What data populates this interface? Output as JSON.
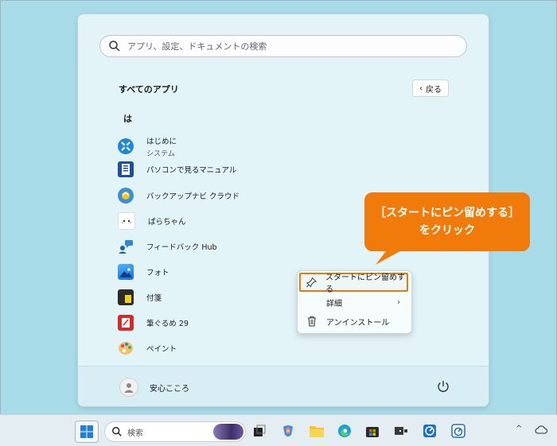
{
  "start_menu": {
    "search_placeholder": "アプリ、設定、ドキュメントの検索",
    "all_apps_title": "すべてのアプリ",
    "back_label": "戻る",
    "section_letter": "は",
    "apps": [
      {
        "name": "はじめに",
        "sub": "システム",
        "icon": "tips-icon"
      },
      {
        "name": "パソコンで見るマニュアル",
        "sub": "",
        "icon": "manual-icon"
      },
      {
        "name": "バックアップナビ クラウド",
        "sub": "",
        "icon": "backup-navi-icon"
      },
      {
        "name": "ぱらちゃん",
        "sub": "",
        "icon": "parachan-icon"
      },
      {
        "name": "フィードバック Hub",
        "sub": "",
        "icon": "feedback-hub-icon"
      },
      {
        "name": "フォト",
        "sub": "",
        "icon": "photos-icon"
      },
      {
        "name": "付箋",
        "sub": "",
        "icon": "sticky-notes-icon"
      },
      {
        "name": "筆ぐるめ 29",
        "sub": "",
        "icon": "fudegurume-icon"
      },
      {
        "name": "ペイント",
        "sub": "",
        "icon": "paint-icon"
      }
    ],
    "user_name": "安心こころ"
  },
  "context_menu": {
    "items": [
      {
        "label": "スタートにピン留めする",
        "icon": "pin-icon"
      },
      {
        "label": "詳細",
        "icon": ""
      },
      {
        "label": "アンインストール",
        "icon": "trash-icon"
      }
    ],
    "more_chevron": "›"
  },
  "callout": {
    "line1": "［スタートにピン留めする］",
    "line2": "をクリック"
  },
  "taskbar": {
    "search_placeholder": "検索",
    "tray_up_arrow": "^"
  },
  "colors": {
    "accent_orange": "#f07a0a",
    "desktop": "#a8dbe8",
    "menu_bg": "#e3f4f8"
  }
}
